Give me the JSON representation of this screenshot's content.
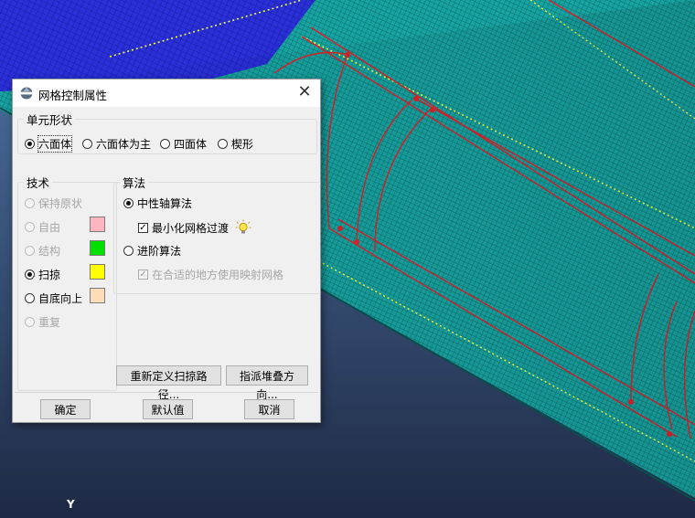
{
  "dialog": {
    "title": "网格控制属性",
    "close_glyph": "✕",
    "element_shape": {
      "legend": "单元形状",
      "options": [
        "六面体",
        "六面体为主",
        "四面体",
        "楔形"
      ],
      "selected": "六面体"
    },
    "technique": {
      "legend": "技术",
      "options": [
        {
          "label": "保持原状",
          "enabled": false,
          "selected": false
        },
        {
          "label": "自由",
          "enabled": false,
          "selected": false,
          "color": "#ffb6c1"
        },
        {
          "label": "结构",
          "enabled": false,
          "selected": false,
          "color": "#00e000"
        },
        {
          "label": "扫掠",
          "enabled": true,
          "selected": true,
          "color": "#ffff00"
        },
        {
          "label": "自底向上",
          "enabled": true,
          "selected": false,
          "color": "#ffdcb8"
        },
        {
          "label": "重复",
          "enabled": false,
          "selected": false
        }
      ]
    },
    "algorithm": {
      "legend": "算法",
      "medial_axis": "中性轴算法",
      "minimize_transition": "最小化网格过渡",
      "advancing_front": "进阶算法",
      "use_mapped_meshing": "在合适的地方使用映射网格",
      "selected": "中性轴算法"
    },
    "buttons": {
      "redefine_sweep_path": "重新定义扫掠路径...",
      "assign_stack_direction": "指派堆叠方向...",
      "ok": "确定",
      "defaults": "默认值",
      "cancel": "取消"
    }
  },
  "viewport": {
    "axis_label": "Y",
    "background_top": "#4a6f9c",
    "background_bottom": "#1f2a45",
    "mesh_color": "#1ca7a4",
    "partition_color": "#e2202a"
  }
}
